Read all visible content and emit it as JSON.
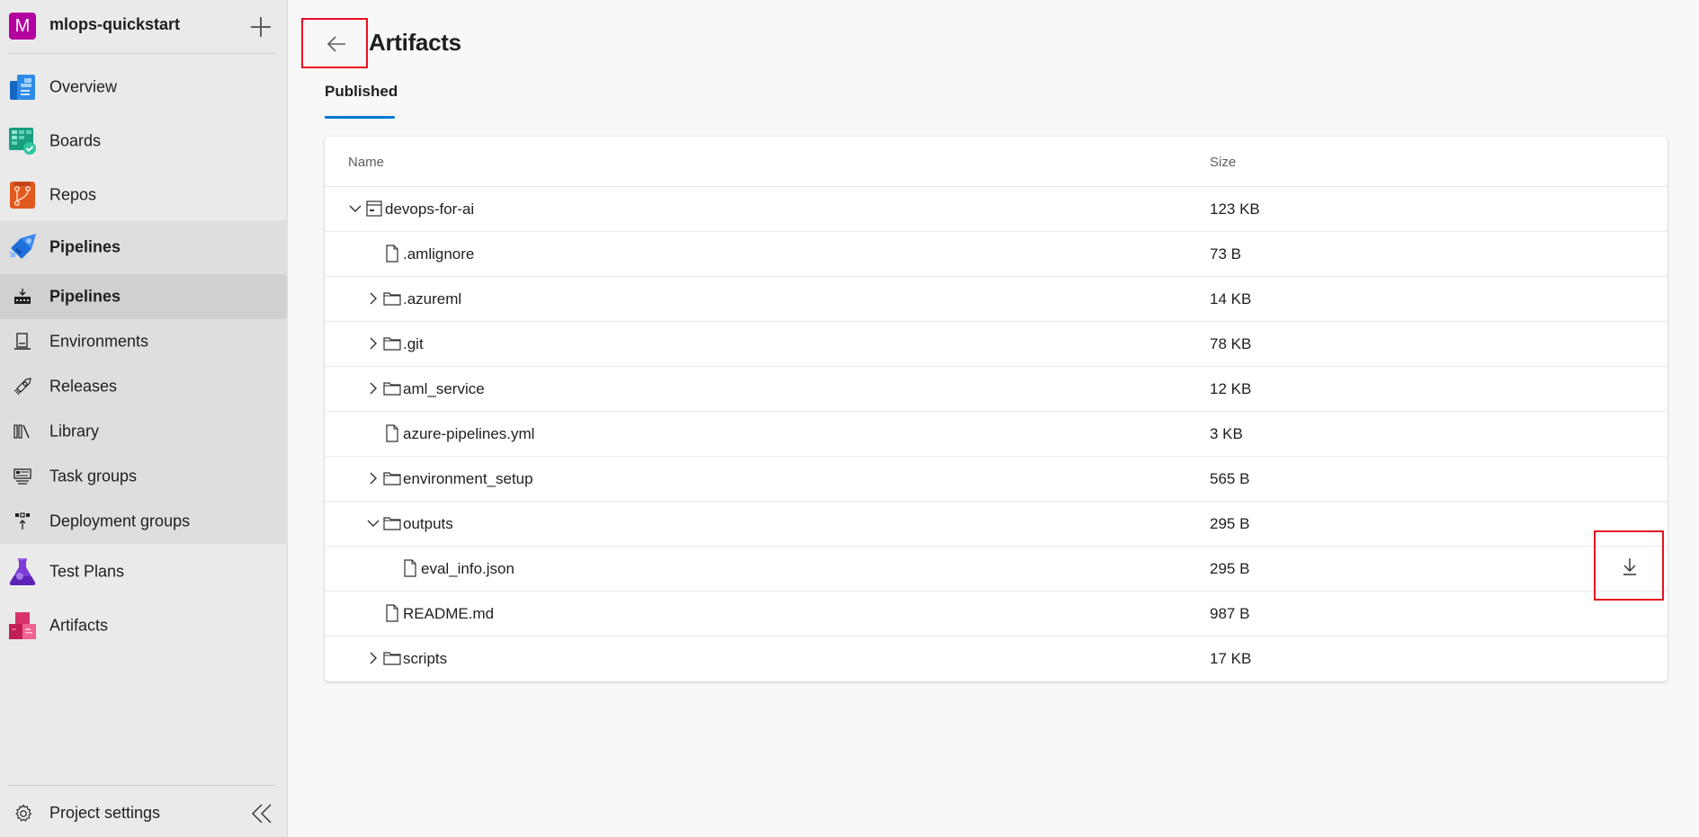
{
  "project": {
    "initial": "M",
    "name": "mlops-quickstart",
    "avatar_color": "#b4009e",
    "add_icon": "plus-icon"
  },
  "sidebar": {
    "items": [
      {
        "label": "Overview",
        "icon": "overview-icon"
      },
      {
        "label": "Boards",
        "icon": "boards-icon"
      },
      {
        "label": "Repos",
        "icon": "repos-icon"
      },
      {
        "label": "Pipelines",
        "icon": "pipelines-rocket-icon",
        "expanded": true
      },
      {
        "label": "Test Plans",
        "icon": "test-plans-icon"
      },
      {
        "label": "Artifacts",
        "icon": "artifacts-icon"
      }
    ],
    "pipelines_sub": [
      {
        "label": "Pipelines",
        "icon": "pipelines-icon",
        "selected": true
      },
      {
        "label": "Environments",
        "icon": "environments-icon"
      },
      {
        "label": "Releases",
        "icon": "releases-icon"
      },
      {
        "label": "Library",
        "icon": "library-icon"
      },
      {
        "label": "Task groups",
        "icon": "task-groups-icon"
      },
      {
        "label": "Deployment groups",
        "icon": "deployment-groups-icon"
      }
    ],
    "footer": {
      "settings_label": "Project settings",
      "settings_icon": "gear-icon",
      "collapse_icon": "double-chevron-left-icon"
    }
  },
  "header": {
    "title": "Artifacts",
    "back_icon": "arrow-left-icon"
  },
  "tabs": [
    {
      "label": "Published",
      "active": true
    }
  ],
  "accent_color": "#0078d4",
  "table": {
    "columns": [
      "Name",
      "Size"
    ],
    "rows": [
      {
        "name": "devops-for-ai",
        "size": "123 KB",
        "type": "artifact",
        "level": 0,
        "expanded": true
      },
      {
        "name": ".amlignore",
        "size": "73 B",
        "type": "file",
        "level": 1
      },
      {
        "name": ".azureml",
        "size": "14 KB",
        "type": "folder",
        "level": 1,
        "expanded": false
      },
      {
        "name": ".git",
        "size": "78 KB",
        "type": "folder",
        "level": 1,
        "expanded": false
      },
      {
        "name": "aml_service",
        "size": "12 KB",
        "type": "folder",
        "level": 1,
        "expanded": false
      },
      {
        "name": "azure-pipelines.yml",
        "size": "3 KB",
        "type": "file",
        "level": 1
      },
      {
        "name": "environment_setup",
        "size": "565 B",
        "type": "folder",
        "level": 1,
        "expanded": false
      },
      {
        "name": "outputs",
        "size": "295 B",
        "type": "folder",
        "level": 1,
        "expanded": true
      },
      {
        "name": "eval_info.json",
        "size": "295 B",
        "type": "file",
        "level": 2,
        "download_icon": "download-icon"
      },
      {
        "name": "README.md",
        "size": "987 B",
        "type": "file",
        "level": 1
      },
      {
        "name": "scripts",
        "size": "17 KB",
        "type": "folder",
        "level": 1,
        "expanded": false
      }
    ]
  }
}
